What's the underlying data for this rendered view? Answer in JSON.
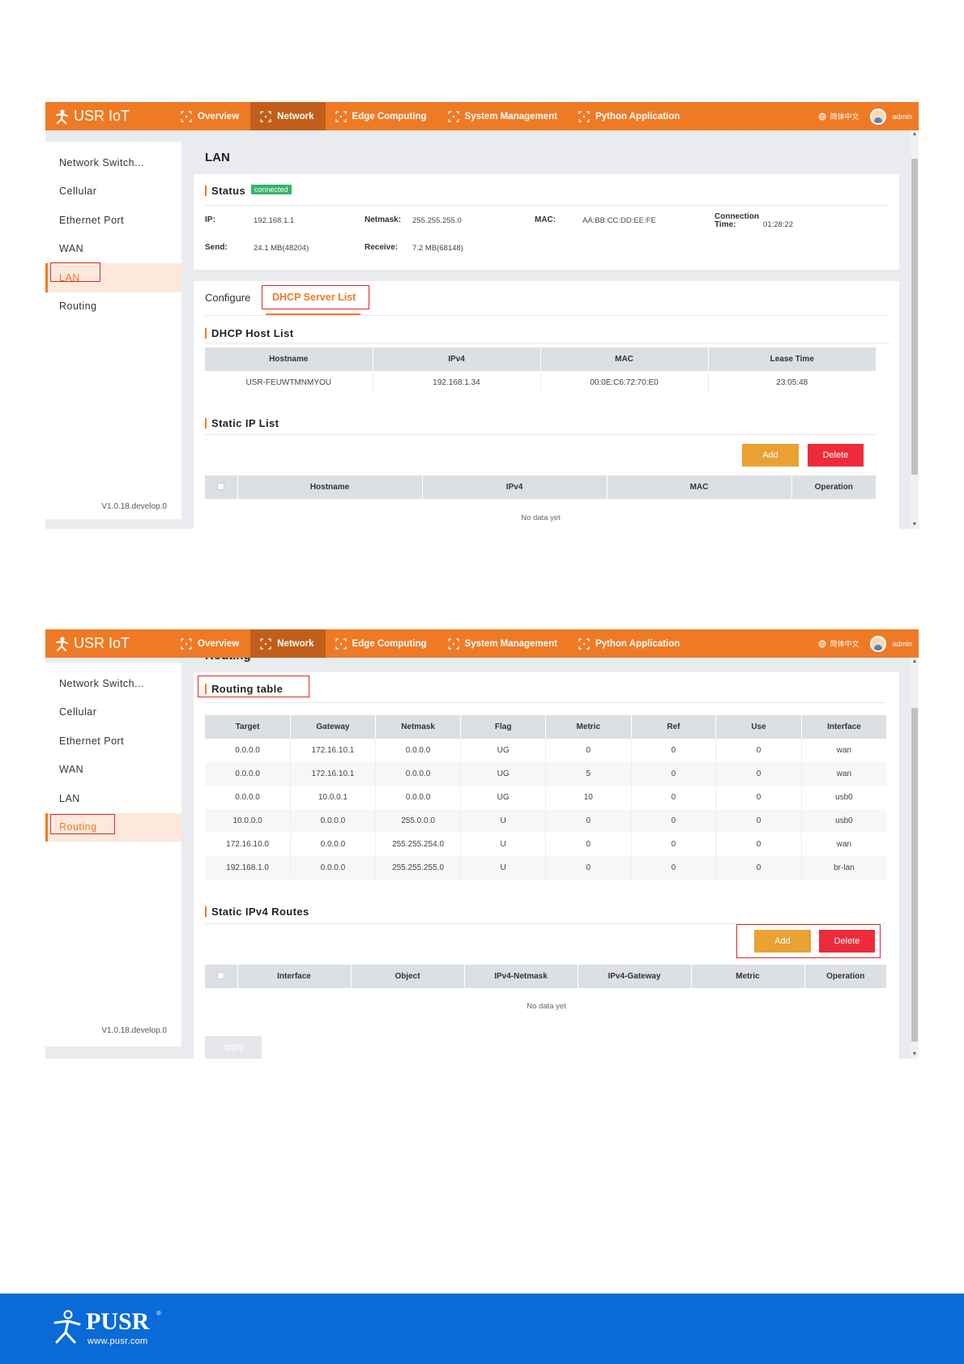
{
  "nav": {
    "brand": "USR IoT",
    "items": [
      "Overview",
      "Network",
      "Edge Computing",
      "System Management",
      "Python Application"
    ],
    "active_index": 1,
    "language": "简体中文",
    "user": "admin"
  },
  "sidebar": {
    "items": [
      "Network Switch...",
      "Cellular",
      "Ethernet Port",
      "WAN",
      "LAN",
      "Routing"
    ],
    "version": "V1.0.18.develop.0"
  },
  "lan_screen": {
    "page_title": "LAN",
    "status_title": "Status",
    "status_badge": "connected",
    "fields": {
      "ip_label": "IP:",
      "ip_value": "192.168.1.1",
      "netmask_label": "Netmask:",
      "netmask_value": "255.255.255.0",
      "mac_label": "MAC:",
      "mac_value": "AA:BB:CC:DD:EE:FE",
      "conn_label_1": "Connection",
      "conn_label_2": "Time:",
      "conn_value": "01:28:22",
      "send_label": "Send:",
      "send_value": "24.1 MB(48204)",
      "receive_label": "Receive:",
      "receive_value": "7.2 MB(68148)"
    },
    "tabs": [
      "Configure",
      "DHCP Server List"
    ],
    "active_tab": 1,
    "dhcp_title": "DHCP Host List",
    "dhcp_columns": [
      "Hostname",
      "IPv4",
      "MAC",
      "Lease Time"
    ],
    "dhcp_rows": [
      [
        "USR-FEUWTMNMYOU",
        "192.168.1.34",
        "00:0E:C6:72:70:E0",
        "23:05:48"
      ]
    ],
    "static_title": "Static IP List",
    "add_label": "Add",
    "delete_label": "Delete",
    "static_columns": [
      "Hostname",
      "IPv4",
      "MAC",
      "Operation"
    ],
    "empty_text": "No data yet"
  },
  "routing_screen": {
    "cut_title": "Routing",
    "routing_title": "Routing table",
    "columns": [
      "Target",
      "Gateway",
      "Netmask",
      "Flag",
      "Metric",
      "Ref",
      "Use",
      "Interface"
    ],
    "rows": [
      [
        "0.0.0.0",
        "172.16.10.1",
        "0.0.0.0",
        "UG",
        "0",
        "0",
        "0",
        "wan"
      ],
      [
        "0.0.0.0",
        "172.16.10.1",
        "0.0.0.0",
        "UG",
        "5",
        "0",
        "0",
        "wan"
      ],
      [
        "0.0.0.0",
        "10.0.0.1",
        "0.0.0.0",
        "UG",
        "10",
        "0",
        "0",
        "usb0"
      ],
      [
        "10.0.0.0",
        "0.0.0.0",
        "255.0.0.0",
        "U",
        "0",
        "0",
        "0",
        "usb0"
      ],
      [
        "172.16.10.0",
        "0.0.0.0",
        "255.255.254.0",
        "U",
        "0",
        "0",
        "0",
        "wan"
      ],
      [
        "192.168.1.0",
        "0.0.0.0",
        "255.255.255.0",
        "U",
        "0",
        "0",
        "0",
        "br-lan"
      ]
    ],
    "static_title": "Static IPv4 Routes",
    "add_label": "Add",
    "delete_label": "Delete",
    "static_columns": [
      "Interface",
      "Object",
      "IPv4-Netmask",
      "IPv4-Gateway",
      "Metric",
      "Operation"
    ],
    "empty_text": "No data yet",
    "apply_label": "apply"
  },
  "footer": {
    "logo_text": "PUSR",
    "url": "www.pusr.com"
  },
  "colors": {
    "accent": "#ef7a25",
    "highlight": "#e0262c",
    "footer": "#0a6ad7"
  }
}
